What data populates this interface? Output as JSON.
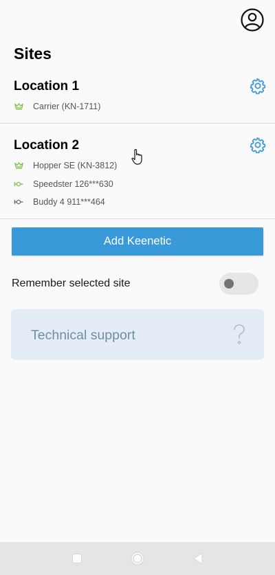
{
  "header": {
    "title": "Sites",
    "profile_icon": "user-circle-icon"
  },
  "sites": [
    {
      "name": "Location 1",
      "settings_icon": "gear-icon",
      "devices": [
        {
          "label": "Carrier (KN-1711)",
          "icon": "crown-icon",
          "color": "#7cc04b"
        }
      ]
    },
    {
      "name": "Location 2",
      "settings_icon": "gear-icon",
      "devices": [
        {
          "label": "Hopper SE (KN-3812)",
          "icon": "crown-icon",
          "color": "#7cc04b"
        },
        {
          "label": "Speedster 126***630",
          "icon": "extender-icon",
          "color": "#7cc04b"
        },
        {
          "label": "Buddy 4 911***464",
          "icon": "extender-icon",
          "color": "#666666"
        }
      ]
    }
  ],
  "actions": {
    "add_label": "Add Keenetic"
  },
  "remember": {
    "label": "Remember selected site",
    "enabled": false
  },
  "support": {
    "label": "Technical support",
    "icon": "question-mark-icon"
  },
  "colors": {
    "accent": "#3a9ad9",
    "online": "#7cc04b",
    "offline": "#666666",
    "support_bg": "#e4edf6",
    "support_text": "#6f8ea6"
  },
  "navbar": {
    "icons": [
      "recents-square-icon",
      "home-circle-icon",
      "back-triangle-icon"
    ]
  }
}
